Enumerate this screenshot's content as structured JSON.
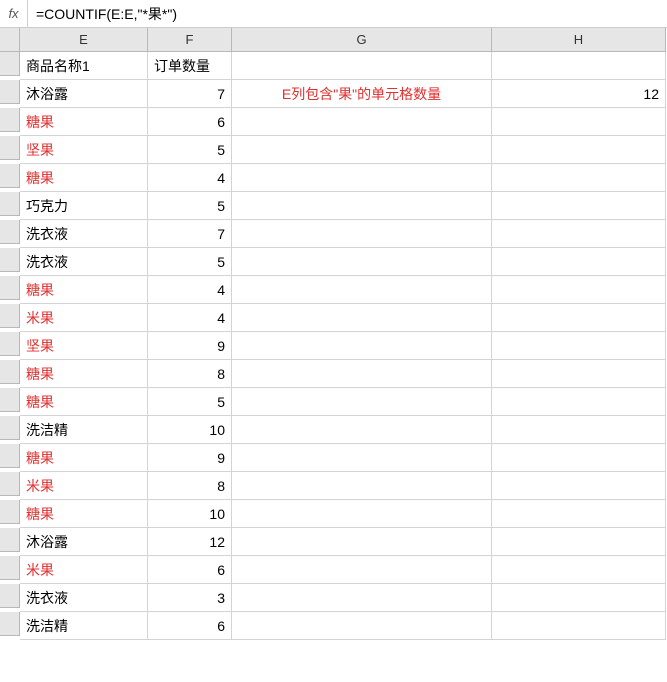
{
  "formula_bar": {
    "fx_label": "fx",
    "formula": "=COUNTIF(E:E,\"*果*\")"
  },
  "columns": [
    "E",
    "F",
    "G",
    "H"
  ],
  "headers": {
    "E": "商品名称1",
    "F": "订单数量"
  },
  "note": {
    "label": "E列包含\"果\"的单元格数量",
    "result": 12
  },
  "rows": [
    {
      "name": "沐浴露",
      "qty": 7,
      "highlight": false
    },
    {
      "name": "糖果",
      "qty": 6,
      "highlight": true
    },
    {
      "name": "坚果",
      "qty": 5,
      "highlight": true
    },
    {
      "name": "糖果",
      "qty": 4,
      "highlight": true
    },
    {
      "name": "巧克力",
      "qty": 5,
      "highlight": false
    },
    {
      "name": "洗衣液",
      "qty": 7,
      "highlight": false
    },
    {
      "name": "洗衣液",
      "qty": 5,
      "highlight": false
    },
    {
      "name": "糖果",
      "qty": 4,
      "highlight": true
    },
    {
      "name": "米果",
      "qty": 4,
      "highlight": true
    },
    {
      "name": "坚果",
      "qty": 9,
      "highlight": true
    },
    {
      "name": "糖果",
      "qty": 8,
      "highlight": true
    },
    {
      "name": "糖果",
      "qty": 5,
      "highlight": true
    },
    {
      "name": "洗洁精",
      "qty": 10,
      "highlight": false
    },
    {
      "name": "糖果",
      "qty": 9,
      "highlight": true
    },
    {
      "name": "米果",
      "qty": 8,
      "highlight": true
    },
    {
      "name": "糖果",
      "qty": 10,
      "highlight": true
    },
    {
      "name": "沐浴露",
      "qty": 12,
      "highlight": false
    },
    {
      "name": "米果",
      "qty": 6,
      "highlight": true
    },
    {
      "name": "洗衣液",
      "qty": 3,
      "highlight": false
    },
    {
      "name": "洗洁精",
      "qty": 6,
      "highlight": false
    }
  ]
}
